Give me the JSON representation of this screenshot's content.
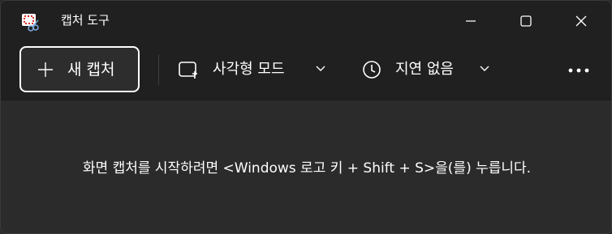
{
  "window": {
    "title": "캡처 도구",
    "controls": [
      "minimize",
      "maximize",
      "close"
    ]
  },
  "toolbar": {
    "new_capture_label": "새 캡처",
    "mode_label": "사각형 모드",
    "delay_label": "지연 없음",
    "more_icon": "more-icon"
  },
  "content": {
    "instruction": "화면 캡처를 시작하려면 <Windows 로고 키 + Shift + S>을(를) 누릅니다."
  },
  "colors": {
    "titlebar_bg": "#202020",
    "content_bg": "#2b2b2b",
    "text": "#ffffff",
    "icon_red": "#d9302c"
  }
}
